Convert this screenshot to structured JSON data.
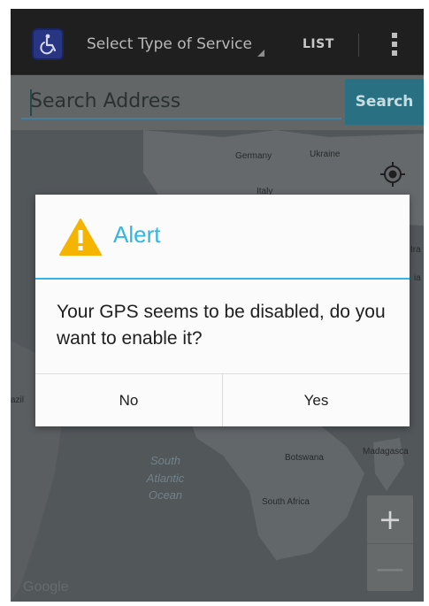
{
  "action_bar": {
    "app_icon": "wheelchair-accessibility-icon",
    "service_select_label": "Select Type of Service",
    "list_label": "LIST",
    "overflow_icon": "overflow-menu-icon"
  },
  "search": {
    "placeholder": "Search Address",
    "button_label": "Search"
  },
  "map": {
    "labels": {
      "germany": "Germany",
      "ukraine": "Ukraine",
      "italy": "Italy",
      "botswana": "Botswana",
      "madagascar": "Madagasca",
      "south_africa": "South Africa",
      "right_edge_top": "Ira",
      "right_edge_mid": "ia",
      "left_edge": "azil"
    },
    "ocean": [
      "South",
      "Atlantic",
      "Ocean"
    ],
    "zoom_in_label": "+",
    "zoom_out_label": "—",
    "attribution": "Google",
    "locate_icon": "my-location-icon"
  },
  "dialog": {
    "icon": "warning-icon",
    "title": "Alert",
    "message": "Your GPS seems to be disabled, do you want to enable it?",
    "negative_label": "No",
    "positive_label": "Yes"
  },
  "colors": {
    "accent": "#33b5e5",
    "warning": "#f4b400",
    "action_bar": "#222222",
    "search_button": "#2c7a8e"
  }
}
